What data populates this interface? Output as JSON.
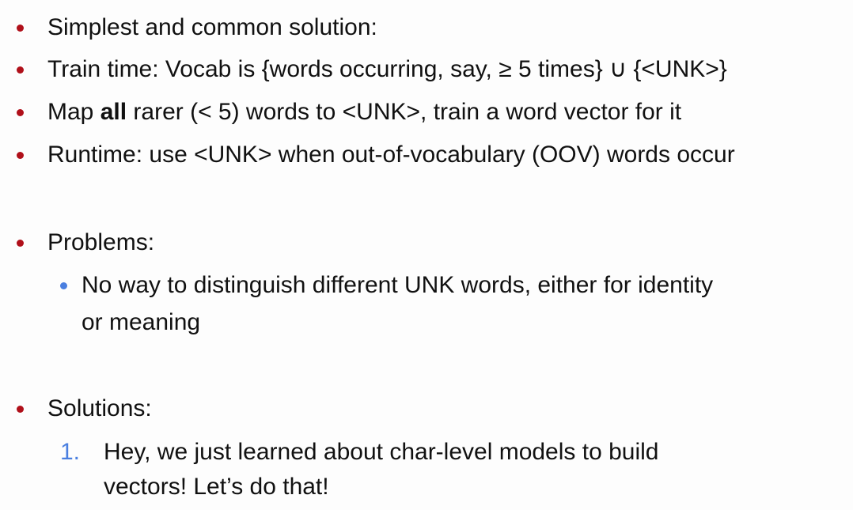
{
  "bullets": [
    {
      "text": "Simplest and common solution:"
    },
    {
      "text": "Train time: Vocab is {words occurring, say, ≥ 5 times} ∪ {<UNK>}"
    },
    {
      "pre": "Map ",
      "bold": "all",
      "post": " rarer (< 5) words to <UNK>, train a word vector for it"
    },
    {
      "text": "Runtime: use <UNK> when out-of-vocabulary (OOV) words occur"
    },
    {
      "text": "Problems:"
    },
    {
      "text": "Solutions:"
    }
  ],
  "problems_sub": {
    "line1": "No way to distinguish different UNK words, either for identity",
    "line2": "or meaning"
  },
  "solutions_list": [
    {
      "number": "1.",
      "line1": "Hey, we just learned about char-level models to build",
      "line2": "vectors! Let’s do that!"
    }
  ],
  "colors": {
    "main_bullet": "#b0101a",
    "sub_bullet": "#4a7fe0"
  }
}
